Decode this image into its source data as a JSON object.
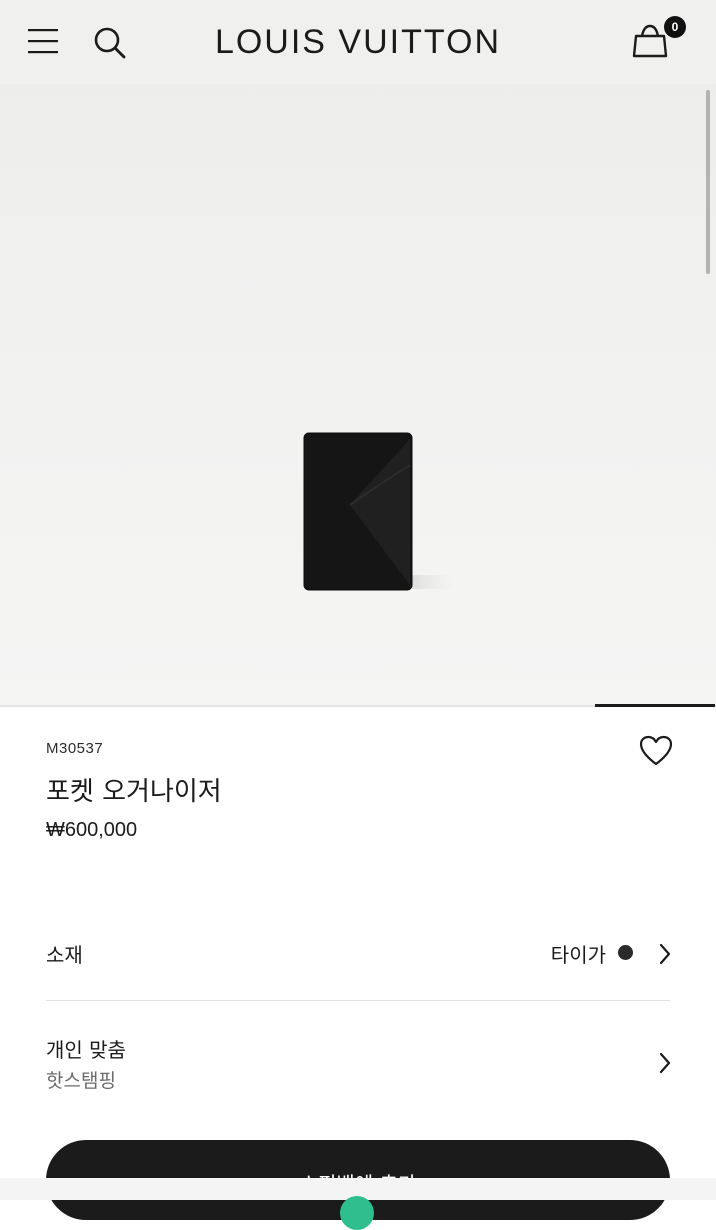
{
  "header": {
    "brand": "LOUIS VUITTON",
    "cart_count": "0",
    "icons": [
      "menu-icon",
      "search-icon",
      "shopping-bag-icon"
    ]
  },
  "gallery": {
    "progress_fraction": 0.17
  },
  "product": {
    "sku": "M30537",
    "name": "포켓 오거나이저",
    "price": "₩600,000"
  },
  "options": {
    "material": {
      "label": "소재",
      "value": "타이가",
      "swatch_color": "#2a2a2a"
    },
    "personalization": {
      "title": "개인 맞춤",
      "subtitle": "핫스탬핑"
    }
  },
  "cta": {
    "add_to_cart_label": "쇼핑백에 추가"
  },
  "colors": {
    "text": "#1b1b1b",
    "secondary_text": "#6b6b6b",
    "button_bg": "#1b1b1b",
    "bottom_accent": "#2fbf8f"
  }
}
